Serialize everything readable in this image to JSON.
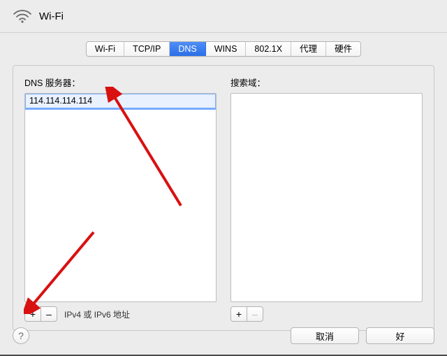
{
  "title": "Wi-Fi",
  "tabs": [
    "Wi-Fi",
    "TCP/IP",
    "DNS",
    "WINS",
    "802.1X",
    "代理",
    "硬件"
  ],
  "active_tab": "DNS",
  "left_label": "DNS 服务器：",
  "right_label": "搜索域：",
  "dns_value": "114.114.114.114",
  "ip_hint": "IPv4 或 IPv6 地址",
  "plus": "+",
  "minus": "–",
  "help": "?",
  "cancel": "取消",
  "ok": "好"
}
